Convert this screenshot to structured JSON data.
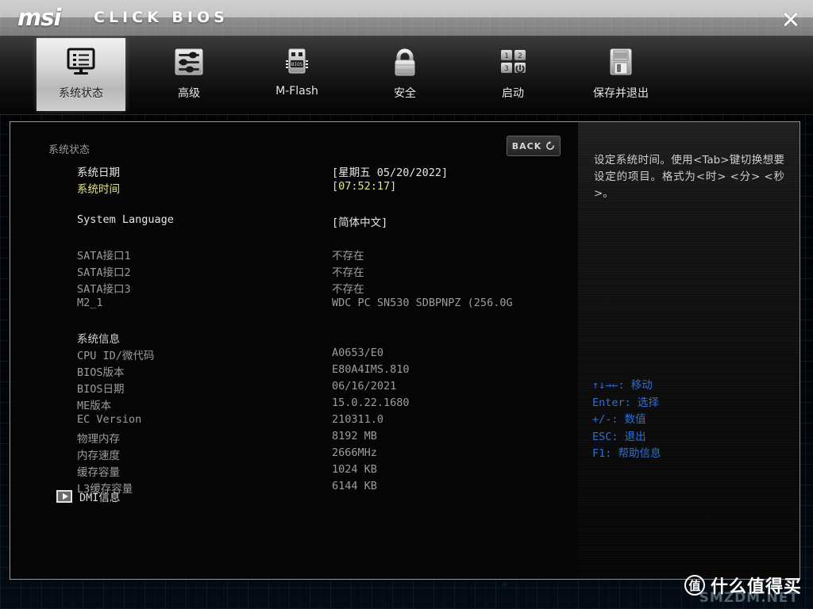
{
  "header": {
    "brand": "msi",
    "product": "CLICK BIOS",
    "close_icon": "close-icon"
  },
  "nav": {
    "items": [
      {
        "label": "系统状态",
        "icon": "monitor-icon",
        "active": true
      },
      {
        "label": "高级",
        "icon": "sliders-icon",
        "active": false
      },
      {
        "label": "M-Flash",
        "icon": "usb-bios-icon",
        "active": false
      },
      {
        "label": "安全",
        "icon": "padlock-icon",
        "active": false
      },
      {
        "label": "启动",
        "icon": "boot-order-icon",
        "active": false
      },
      {
        "label": "保存并退出",
        "icon": "floppy-disk-icon",
        "active": false
      }
    ]
  },
  "main": {
    "title": "系统状态",
    "back_label": "BACK",
    "back_icon": "undo-arrow-icon",
    "rows": [
      {
        "label": "系统日期",
        "value": "[星期五 05/20/2022]",
        "style": "white",
        "indent": 1
      },
      {
        "label": "系统时间",
        "value": "[07:52:17]",
        "style": "yellow",
        "indent": 1
      },
      {
        "label": "",
        "value": "",
        "style": "spacer",
        "indent": 0
      },
      {
        "label": "System Language",
        "value": "[简体中文]",
        "style": "white",
        "indent": 1
      },
      {
        "label": "",
        "value": "",
        "style": "spacer",
        "indent": 0
      },
      {
        "label": "SATA接口1",
        "value": "不存在",
        "style": "dim",
        "indent": 1
      },
      {
        "label": "SATA接口2",
        "value": "不存在",
        "style": "dim",
        "indent": 1
      },
      {
        "label": "SATA接口3",
        "value": "不存在",
        "style": "dim",
        "indent": 1
      },
      {
        "label": "M2_1",
        "value": "WDC PC SN530 SDBPNPZ (256.0G",
        "style": "dim",
        "indent": 1
      },
      {
        "label": "",
        "value": "",
        "style": "spacer",
        "indent": 0
      },
      {
        "label": "系统信息",
        "value": "",
        "style": "group",
        "indent": 1
      },
      {
        "label": "CPU ID/微代码",
        "value": "A0653/E0",
        "style": "dim",
        "indent": 1
      },
      {
        "label": "BIOS版本",
        "value": "E80A4IMS.810",
        "style": "dim",
        "indent": 1
      },
      {
        "label": "BIOS日期",
        "value": "06/16/2021",
        "style": "dim",
        "indent": 1
      },
      {
        "label": "ME版本",
        "value": "15.0.22.1680",
        "style": "dim",
        "indent": 1
      },
      {
        "label": "EC Version",
        "value": "210311.0",
        "style": "dim",
        "indent": 1
      },
      {
        "label": "物理内存",
        "value": "8192 MB",
        "style": "dim",
        "indent": 1
      },
      {
        "label": "内存速度",
        "value": "2666MHz",
        "style": "dim",
        "indent": 1
      },
      {
        "label": "缓存容量",
        "value": "1024 KB",
        "style": "dim",
        "indent": 1
      },
      {
        "label": "L3缓存容量",
        "value": "6144 KB",
        "style": "dim",
        "indent": 1
      }
    ],
    "dmi_label": "DMI信息",
    "dmi_icon": "play-box-icon"
  },
  "help": {
    "description": "设定系统时间。使用<Tab>键切换想要设定的项目。格式为<时> <分> <秒>。",
    "shortcuts": [
      {
        "key": "↑↓→←:",
        "action": "移动"
      },
      {
        "key": "Enter:",
        "action": "选择"
      },
      {
        "key": "+/-:",
        "action": "数值"
      },
      {
        "key": "ESC:",
        "action": "退出"
      },
      {
        "key": "F1:",
        "action": "帮助信息"
      }
    ]
  },
  "watermark": {
    "badge": "值",
    "text": "什么值得买",
    "sub": "SMZDM.NET"
  },
  "colors": {
    "accent_blue": "#2f6fd0",
    "highlight_yellow": "#e4e48a",
    "panel_border": "#9a9a9a"
  }
}
